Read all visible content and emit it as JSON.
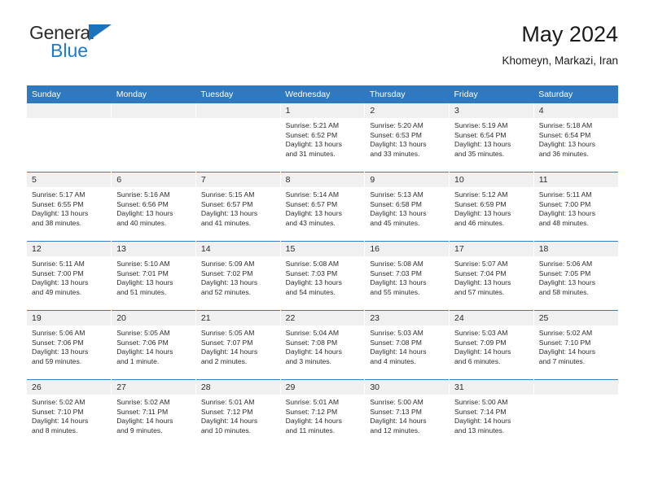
{
  "brand": {
    "word_one": "General",
    "word_two": "Blue",
    "triangle_icon": "triangle-logo-icon"
  },
  "header": {
    "title": "May 2024",
    "subtitle": "Khomeyn, Markazi, Iran"
  },
  "colors": {
    "header_blue": "#2e79c0",
    "brand_blue": "#1b7ad1",
    "daynum_bg": "#f0f0f0",
    "grid_line": "#3a7cc0"
  },
  "weekdays": [
    "Sunday",
    "Monday",
    "Tuesday",
    "Wednesday",
    "Thursday",
    "Friday",
    "Saturday"
  ],
  "labels": {
    "sunrise_prefix": "Sunrise:",
    "sunset_prefix": "Sunset:",
    "daylight_prefix": "Daylight:"
  },
  "weeks": [
    [
      {
        "day": "",
        "sunrise": "",
        "sunset": "",
        "daylight_a": "",
        "daylight_b": "",
        "empty": true
      },
      {
        "day": "",
        "sunrise": "",
        "sunset": "",
        "daylight_a": "",
        "daylight_b": "",
        "empty": true
      },
      {
        "day": "",
        "sunrise": "",
        "sunset": "",
        "daylight_a": "",
        "daylight_b": "",
        "empty": true
      },
      {
        "day": "1",
        "sunrise": "Sunrise: 5:21 AM",
        "sunset": "Sunset: 6:52 PM",
        "daylight_a": "Daylight: 13 hours",
        "daylight_b": "and 31 minutes.",
        "empty": false
      },
      {
        "day": "2",
        "sunrise": "Sunrise: 5:20 AM",
        "sunset": "Sunset: 6:53 PM",
        "daylight_a": "Daylight: 13 hours",
        "daylight_b": "and 33 minutes.",
        "empty": false
      },
      {
        "day": "3",
        "sunrise": "Sunrise: 5:19 AM",
        "sunset": "Sunset: 6:54 PM",
        "daylight_a": "Daylight: 13 hours",
        "daylight_b": "and 35 minutes.",
        "empty": false
      },
      {
        "day": "4",
        "sunrise": "Sunrise: 5:18 AM",
        "sunset": "Sunset: 6:54 PM",
        "daylight_a": "Daylight: 13 hours",
        "daylight_b": "and 36 minutes.",
        "empty": false
      }
    ],
    [
      {
        "day": "5",
        "sunrise": "Sunrise: 5:17 AM",
        "sunset": "Sunset: 6:55 PM",
        "daylight_a": "Daylight: 13 hours",
        "daylight_b": "and 38 minutes.",
        "empty": false
      },
      {
        "day": "6",
        "sunrise": "Sunrise: 5:16 AM",
        "sunset": "Sunset: 6:56 PM",
        "daylight_a": "Daylight: 13 hours",
        "daylight_b": "and 40 minutes.",
        "empty": false
      },
      {
        "day": "7",
        "sunrise": "Sunrise: 5:15 AM",
        "sunset": "Sunset: 6:57 PM",
        "daylight_a": "Daylight: 13 hours",
        "daylight_b": "and 41 minutes.",
        "empty": false
      },
      {
        "day": "8",
        "sunrise": "Sunrise: 5:14 AM",
        "sunset": "Sunset: 6:57 PM",
        "daylight_a": "Daylight: 13 hours",
        "daylight_b": "and 43 minutes.",
        "empty": false
      },
      {
        "day": "9",
        "sunrise": "Sunrise: 5:13 AM",
        "sunset": "Sunset: 6:58 PM",
        "daylight_a": "Daylight: 13 hours",
        "daylight_b": "and 45 minutes.",
        "empty": false
      },
      {
        "day": "10",
        "sunrise": "Sunrise: 5:12 AM",
        "sunset": "Sunset: 6:59 PM",
        "daylight_a": "Daylight: 13 hours",
        "daylight_b": "and 46 minutes.",
        "empty": false
      },
      {
        "day": "11",
        "sunrise": "Sunrise: 5:11 AM",
        "sunset": "Sunset: 7:00 PM",
        "daylight_a": "Daylight: 13 hours",
        "daylight_b": "and 48 minutes.",
        "empty": false
      }
    ],
    [
      {
        "day": "12",
        "sunrise": "Sunrise: 5:11 AM",
        "sunset": "Sunset: 7:00 PM",
        "daylight_a": "Daylight: 13 hours",
        "daylight_b": "and 49 minutes.",
        "empty": false
      },
      {
        "day": "13",
        "sunrise": "Sunrise: 5:10 AM",
        "sunset": "Sunset: 7:01 PM",
        "daylight_a": "Daylight: 13 hours",
        "daylight_b": "and 51 minutes.",
        "empty": false
      },
      {
        "day": "14",
        "sunrise": "Sunrise: 5:09 AM",
        "sunset": "Sunset: 7:02 PM",
        "daylight_a": "Daylight: 13 hours",
        "daylight_b": "and 52 minutes.",
        "empty": false
      },
      {
        "day": "15",
        "sunrise": "Sunrise: 5:08 AM",
        "sunset": "Sunset: 7:03 PM",
        "daylight_a": "Daylight: 13 hours",
        "daylight_b": "and 54 minutes.",
        "empty": false
      },
      {
        "day": "16",
        "sunrise": "Sunrise: 5:08 AM",
        "sunset": "Sunset: 7:03 PM",
        "daylight_a": "Daylight: 13 hours",
        "daylight_b": "and 55 minutes.",
        "empty": false
      },
      {
        "day": "17",
        "sunrise": "Sunrise: 5:07 AM",
        "sunset": "Sunset: 7:04 PM",
        "daylight_a": "Daylight: 13 hours",
        "daylight_b": "and 57 minutes.",
        "empty": false
      },
      {
        "day": "18",
        "sunrise": "Sunrise: 5:06 AM",
        "sunset": "Sunset: 7:05 PM",
        "daylight_a": "Daylight: 13 hours",
        "daylight_b": "and 58 minutes.",
        "empty": false
      }
    ],
    [
      {
        "day": "19",
        "sunrise": "Sunrise: 5:06 AM",
        "sunset": "Sunset: 7:06 PM",
        "daylight_a": "Daylight: 13 hours",
        "daylight_b": "and 59 minutes.",
        "empty": false
      },
      {
        "day": "20",
        "sunrise": "Sunrise: 5:05 AM",
        "sunset": "Sunset: 7:06 PM",
        "daylight_a": "Daylight: 14 hours",
        "daylight_b": "and 1 minute.",
        "empty": false
      },
      {
        "day": "21",
        "sunrise": "Sunrise: 5:05 AM",
        "sunset": "Sunset: 7:07 PM",
        "daylight_a": "Daylight: 14 hours",
        "daylight_b": "and 2 minutes.",
        "empty": false
      },
      {
        "day": "22",
        "sunrise": "Sunrise: 5:04 AM",
        "sunset": "Sunset: 7:08 PM",
        "daylight_a": "Daylight: 14 hours",
        "daylight_b": "and 3 minutes.",
        "empty": false
      },
      {
        "day": "23",
        "sunrise": "Sunrise: 5:03 AM",
        "sunset": "Sunset: 7:08 PM",
        "daylight_a": "Daylight: 14 hours",
        "daylight_b": "and 4 minutes.",
        "empty": false
      },
      {
        "day": "24",
        "sunrise": "Sunrise: 5:03 AM",
        "sunset": "Sunset: 7:09 PM",
        "daylight_a": "Daylight: 14 hours",
        "daylight_b": "and 6 minutes.",
        "empty": false
      },
      {
        "day": "25",
        "sunrise": "Sunrise: 5:02 AM",
        "sunset": "Sunset: 7:10 PM",
        "daylight_a": "Daylight: 14 hours",
        "daylight_b": "and 7 minutes.",
        "empty": false
      }
    ],
    [
      {
        "day": "26",
        "sunrise": "Sunrise: 5:02 AM",
        "sunset": "Sunset: 7:10 PM",
        "daylight_a": "Daylight: 14 hours",
        "daylight_b": "and 8 minutes.",
        "empty": false
      },
      {
        "day": "27",
        "sunrise": "Sunrise: 5:02 AM",
        "sunset": "Sunset: 7:11 PM",
        "daylight_a": "Daylight: 14 hours",
        "daylight_b": "and 9 minutes.",
        "empty": false
      },
      {
        "day": "28",
        "sunrise": "Sunrise: 5:01 AM",
        "sunset": "Sunset: 7:12 PM",
        "daylight_a": "Daylight: 14 hours",
        "daylight_b": "and 10 minutes.",
        "empty": false
      },
      {
        "day": "29",
        "sunrise": "Sunrise: 5:01 AM",
        "sunset": "Sunset: 7:12 PM",
        "daylight_a": "Daylight: 14 hours",
        "daylight_b": "and 11 minutes.",
        "empty": false
      },
      {
        "day": "30",
        "sunrise": "Sunrise: 5:00 AM",
        "sunset": "Sunset: 7:13 PM",
        "daylight_a": "Daylight: 14 hours",
        "daylight_b": "and 12 minutes.",
        "empty": false
      },
      {
        "day": "31",
        "sunrise": "Sunrise: 5:00 AM",
        "sunset": "Sunset: 7:14 PM",
        "daylight_a": "Daylight: 14 hours",
        "daylight_b": "and 13 minutes.",
        "empty": false
      },
      {
        "day": "",
        "sunrise": "",
        "sunset": "",
        "daylight_a": "",
        "daylight_b": "",
        "empty": true
      }
    ]
  ]
}
